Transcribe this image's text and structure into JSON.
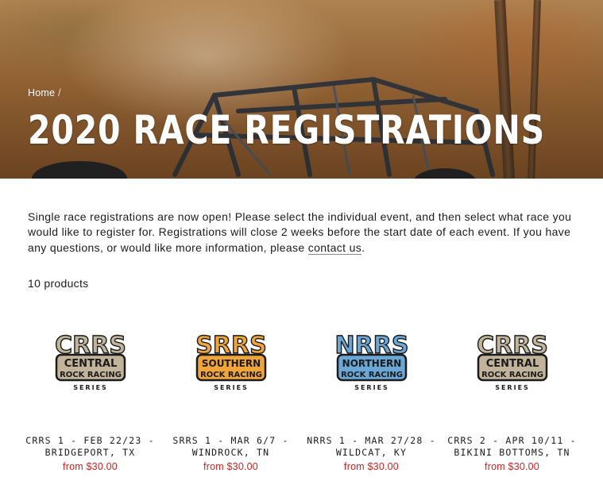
{
  "breadcrumb": {
    "home": "Home",
    "separator": "/"
  },
  "page": {
    "title": "2020 RACE REGISTRATIONS",
    "intro_text": "Single race registrations are now open! Please select the individual event, and then select what race you would like to register for. Registrations will close 2 weeks before the start date of each event. If you have any questions, or would like more information, please ",
    "contact_link": "contact us",
    "intro_end": ".",
    "product_count": "10 products"
  },
  "colors": {
    "central": "#c2b49a",
    "southern": "#f0a53a",
    "northern": "#6aa7d6",
    "price": "#d11f1f"
  },
  "products": [
    {
      "title": "CRRS 1 - FEB 22/23 - BRIDGEPORT, TX",
      "price": "from $30.00",
      "logo": {
        "short": "CRRS",
        "line1": "CENTRAL",
        "line2": "ROCK RACING",
        "line3": "SERIES",
        "icon": "crrs-logo-icon"
      }
    },
    {
      "title": "SRRS 1 - MAR 6/7 - WINDROCK, TN",
      "price": "from $30.00",
      "logo": {
        "short": "SRRS",
        "line1": "SOUTHERN",
        "line2": "ROCK RACING",
        "line3": "SERIES",
        "icon": "srrs-logo-icon"
      }
    },
    {
      "title": "NRRS 1 - MAR 27/28 - WILDCAT, KY",
      "price": "from $30.00",
      "logo": {
        "short": "NRRS",
        "line1": "NORTHERN",
        "line2": "ROCK RACING",
        "line3": "SERIES",
        "icon": "nrrs-logo-icon"
      }
    },
    {
      "title": "CRRS 2 - APR 10/11 - BIKINI BOTTOMS, TN",
      "price": "from $30.00",
      "logo": {
        "short": "CRRS",
        "line1": "CENTRAL",
        "line2": "ROCK RACING",
        "line3": "SERIES",
        "icon": "crrs-logo-icon"
      }
    }
  ]
}
